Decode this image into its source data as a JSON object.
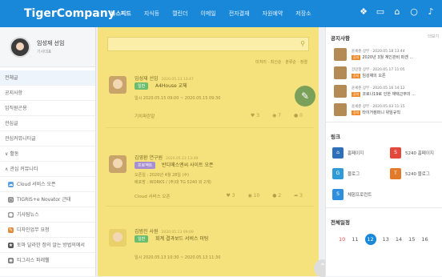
{
  "app": {
    "logo": "TigerCompany"
  },
  "nav": [
    "뉴스피드",
    "지식등",
    "캘린더",
    "이메일",
    "전자결재",
    "자원예약",
    "저장소"
  ],
  "top_icons": [
    "gift-icon",
    "calendar-icon",
    "org-chart-icon",
    "chat-icon",
    "bell-icon"
  ],
  "profile": {
    "name": "임성재 선임",
    "role": "기사대표"
  },
  "left_menu": {
    "items": [
      "전체글",
      "공지사항",
      "임직원곤용",
      "관심글",
      "관심커뮤니티글"
    ],
    "group": "활동",
    "community_header": "관심 커뮤니티",
    "community": [
      {
        "label": "Cloud 서비스 오픈",
        "icon": "cloud-icon",
        "color": "#5aa0e0"
      },
      {
        "label": "TIGRIS+e Novator 근태",
        "icon": "clock-icon",
        "color": "#888888"
      },
      {
        "label": "기사팀뉴스",
        "icon": "news-icon",
        "color": "#999999"
      },
      {
        "label": "디자인업무 요청",
        "icon": "design-icon",
        "color": "#e08a3a"
      },
      {
        "label": "토마 달라한 정의 알는 방법의에서",
        "icon": "star-icon",
        "color": "#555555"
      },
      {
        "label": "티그리스 파레웰",
        "icon": "tiger-icon",
        "color": "#777777"
      }
    ]
  },
  "feed": {
    "search_placeholder": "",
    "filters": "미처리 · 최신순 · 분류순 · 정렬",
    "posts": [
      {
        "author": "임성재 선임",
        "time": "2020.05.13 13:47",
        "tag": "일반",
        "title": "A4House 교체",
        "line1": "일시  2020.05.15 09:00 ~ 2020.05.15 09:30",
        "line2": "",
        "foot": "기치파란알",
        "likes": "3",
        "views": "7",
        "comments": "0",
        "shares": ""
      },
      {
        "author": "김영환 연구원",
        "time": "2020.05.13 13:49",
        "tag": "프로젝트",
        "title": "반디메스엔씨 사이트 오픈",
        "line1": "오픈일 : 2020년 4월 28일 (수)",
        "line2": "배포방 : WORKS / (주)대 TG 5240 외 2개)",
        "foot": "Cloud 서비스 오픈",
        "likes": "3",
        "views": "10",
        "comments": "2",
        "shares": "3"
      },
      {
        "author": "김범진 사원",
        "time": "2020.05.13 09:09",
        "tag": "일반",
        "title": "회계 결과보드 서비스 미팅",
        "line1": "일시  2020.05.13 10:30 ~ 2020.05.13 11:30",
        "line2": "",
        "foot": "",
        "likes": "",
        "views": "",
        "comments": "",
        "shares": ""
      }
    ]
  },
  "notices": {
    "title": "공지사항",
    "more": "더보기",
    "items": [
      {
        "meta": "윤세준 상무 · 2020.05.18 13:44",
        "badge": "공지",
        "text": "2020년 3월 계인관비 파겐 ..."
      },
      {
        "meta": "강민정 상무 · 2020.05.17 11:05",
        "badge": "공지",
        "text": "임성채의 오픈"
      },
      {
        "meta": "윤세준 상무 · 2020.05.16 14:12",
        "badge": "공지",
        "text": "코로나19로 인한 재택근무의 ..."
      },
      {
        "meta": "윤세준 상무 · 2020.05.03 11:15",
        "badge": "공지",
        "text": "타이거컴퍼니 위임규칙"
      }
    ]
  },
  "links": {
    "title": "링크",
    "items": [
      {
        "label": "홈페이지",
        "icon": "home-link-icon",
        "color": "#2d6fb8"
      },
      {
        "label": "5240 홈페이지",
        "icon": "s240-icon",
        "color": "#e2483b"
      },
      {
        "label": "블로그",
        "icon": "blog-icon",
        "color": "#2f9bd6"
      },
      {
        "label": "5240 블로그",
        "icon": "tigris-blog-icon",
        "color": "#e27a2a"
      },
      {
        "label": "체험프로런트",
        "icon": "s-logo-icon",
        "color": "#2d8fdd"
      }
    ]
  },
  "schedule": {
    "title": "전체일정",
    "days": [
      "10",
      "11",
      "12",
      "13",
      "14",
      "15",
      "16"
    ],
    "today": "12"
  }
}
